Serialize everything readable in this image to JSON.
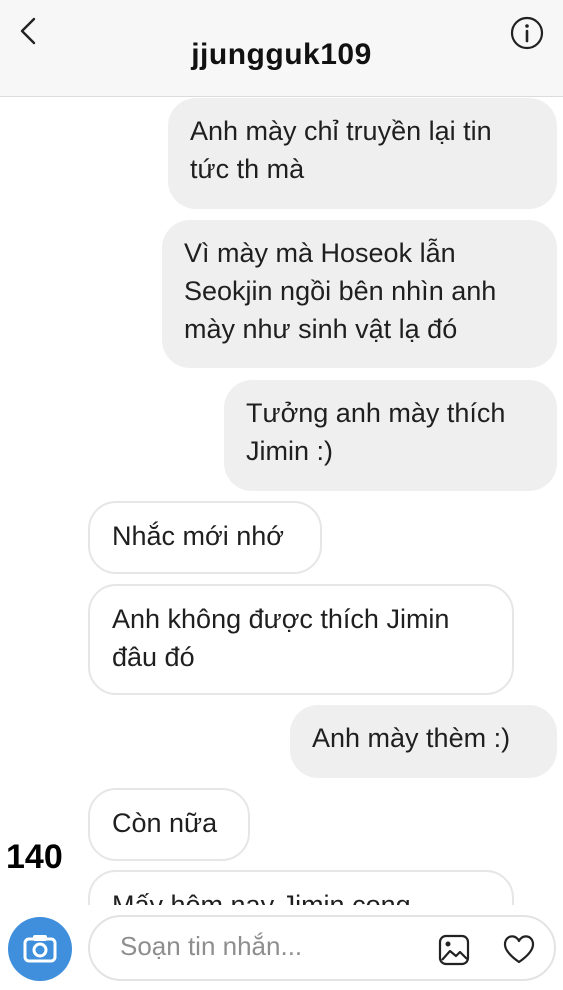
{
  "header": {
    "title": "jjungguk109",
    "back_icon": "chevron-left-icon",
    "info_icon": "info-icon"
  },
  "messages": [
    {
      "direction": "sent",
      "lines": [
        "Anh mày chỉ truyền lại tin",
        "tức th mà"
      ]
    },
    {
      "direction": "sent",
      "lines": [
        "Vì mày mà Hoseok lẫn",
        "Seokjin ngồi bên nhìn anh",
        "mày như sinh vật lạ đó"
      ]
    },
    {
      "direction": "sent",
      "lines": [
        "Tưởng anh mày thích",
        "Jimin :)"
      ]
    },
    {
      "direction": "received",
      "lines": [
        "Nhắc mới nhớ"
      ]
    },
    {
      "direction": "received",
      "lines": [
        "Anh không được thích Jimin",
        "đâu đó"
      ]
    },
    {
      "direction": "sent",
      "lines": [
        "Anh mày thèm :)"
      ]
    },
    {
      "direction": "received",
      "lines": [
        "Còn nữa"
      ]
    },
    {
      "direction": "received",
      "lines": [
        "Mấy hôm nay Jimin cong"
      ]
    }
  ],
  "overlay_number": "140",
  "composer": {
    "placeholder": "Soạn tin nhắn...",
    "camera_icon": "camera-icon",
    "gallery_icon": "gallery-icon",
    "heart_icon": "heart-icon"
  },
  "colors": {
    "sent_bubble": "#efefef",
    "received_border": "#e6e6e6",
    "camera_button": "#3f8fdc",
    "placeholder_text": "#8e8e8e"
  }
}
